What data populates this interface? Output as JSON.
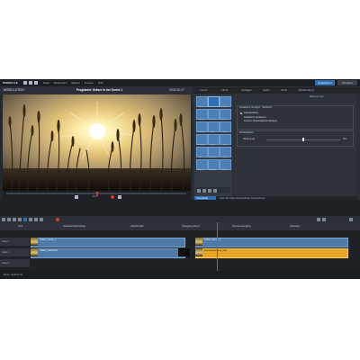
{
  "app": {
    "logo": "PINNACLE",
    "menu": [
      "Datei",
      "Bearbeiten",
      "Effekte",
      "Fenster",
      "Hilfe"
    ],
    "top_buttons": {
      "primary": "Exportieren",
      "secondary": "Rendern"
    }
  },
  "editor": {
    "left_title": "MODELLSTEIN",
    "project_title": "Programm: Gräser in der Sonne 1",
    "timecode_top": "00:00:00.17",
    "preview_timecode": "00:17"
  },
  "right_panel": {
    "tabs": [
      "Import",
      "Filme",
      "Vorlagen",
      "Audio",
      "Texte",
      "Einblendung"
    ],
    "effects_labels": [
      "Farbe",
      "Stabil.",
      "Chroma",
      "Effekt",
      "Schärfe",
      "Kontrast",
      "Schwarz",
      "Weiß",
      "Zoom",
      "Bewegen",
      "Vignette",
      "Glow",
      "Blur",
      "Mosaik",
      "Licht",
      "Rahmen",
      "Spiegeln",
      "Drehen"
    ],
    "properties": {
      "section_title": "Detaillierte Vorlagen · Mehrfach",
      "options": [
        "Standardfarbe",
        "Detaillierte Farbwerte",
        "Farbton (Weißabgleich-Abfrage)"
      ],
      "subsection": "Weißabgleich",
      "slider_label": "Weiß-Level",
      "slider_value": "0%",
      "panel_title": "Balance-Kopf"
    },
    "bottom_tab": "Videoeffekte",
    "bottom_text": "Lade: Alle Clips (Voreinstellung: Voreinstellung)"
  },
  "timeline": {
    "ruler_labels": [
      "00:00:00:00",
      "Intro",
      "Grasfeld Nachmittags",
      "Zwischenfall",
      "Übergang Abend",
      "Sonnenuntergang",
      "Heimweg"
    ],
    "track_labels": [
      "Video 1",
      "Audio 1",
      "Video 2"
    ],
    "clip_labels": [
      "Gräser_Sonne_1",
      "Gräser_Sonne_2",
      "Gräser_Weitwinkel",
      "Sonnenuntergang_final"
    ],
    "status": "Bereit · 00:00:21:10"
  },
  "colors": {
    "accent": "#2f6fb3",
    "clip_blue": "#4f79a6",
    "clip_yellow": "#e6a526",
    "background": "#24282d"
  }
}
